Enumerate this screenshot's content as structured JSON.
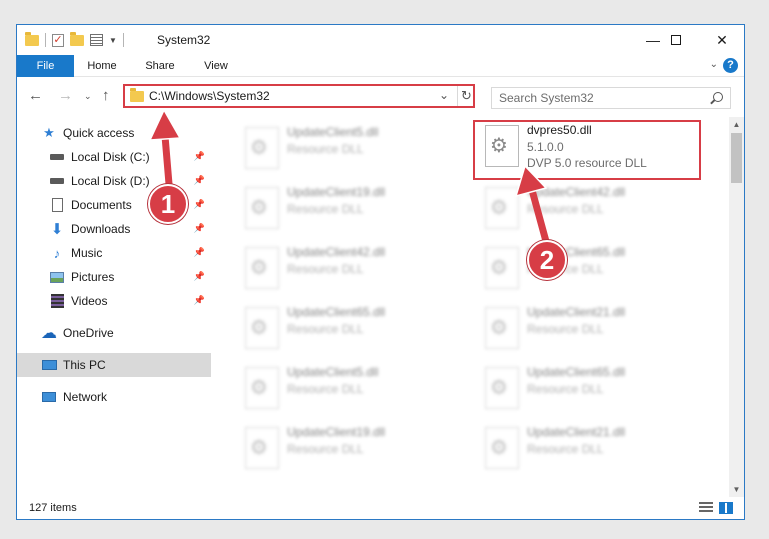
{
  "window": {
    "title": "System32"
  },
  "ribbon": {
    "tabs": [
      {
        "label": "File"
      },
      {
        "label": "Home"
      },
      {
        "label": "Share"
      },
      {
        "label": "View"
      }
    ]
  },
  "address": {
    "path": "C:\\Windows\\System32"
  },
  "search": {
    "placeholder": "Search System32"
  },
  "nav_pane": {
    "items": [
      {
        "label": "Quick access",
        "icon": "star-icon"
      },
      {
        "label": "Local Disk (C:)",
        "icon": "drive-icon",
        "pinned": true
      },
      {
        "label": "Local Disk (D:)",
        "icon": "drive-icon",
        "pinned": true
      },
      {
        "label": "Documents",
        "icon": "document-icon",
        "pinned": true
      },
      {
        "label": "Downloads",
        "icon": "download-icon",
        "pinned": true
      },
      {
        "label": "Music",
        "icon": "music-icon",
        "pinned": true
      },
      {
        "label": "Pictures",
        "icon": "pictures-icon",
        "pinned": true
      },
      {
        "label": "Videos",
        "icon": "videos-icon",
        "pinned": true
      },
      {
        "label": "OneDrive",
        "icon": "cloud-icon"
      },
      {
        "label": "This PC",
        "icon": "computer-icon",
        "selected": true
      },
      {
        "label": "Network",
        "icon": "network-icon"
      }
    ]
  },
  "files": {
    "left_column": [
      {
        "name": "UpdateClient5.dll",
        "type": "Resource DLL"
      },
      {
        "name": "UpdateClient19.dll",
        "type": "Resource DLL"
      },
      {
        "name": "UpdateClient42.dll",
        "type": "Resource DLL"
      },
      {
        "name": "UpdateClient65.dll",
        "type": "Resource DLL"
      },
      {
        "name": "UpdateClient5.dll",
        "type": "Resource DLL"
      },
      {
        "name": "UpdateClient19.dll",
        "type": "Resource DLL"
      }
    ],
    "right_column": [
      {
        "name": "UpdateClient42.dll",
        "type": "Resource DLL"
      },
      {
        "name": "UpdateClient65.dll",
        "type": "Resource DLL"
      },
      {
        "name": "UpdateClient21.dll",
        "type": "Resource DLL"
      },
      {
        "name": "UpdateClient65.dll",
        "type": "Resource DLL"
      },
      {
        "name": "UpdateClient21.dll",
        "type": "Resource DLL"
      }
    ],
    "highlighted": {
      "name": "dvpres50.dll",
      "version": "5.1.0.0",
      "description": "DVP 5.0 resource DLL"
    }
  },
  "status": {
    "item_count": "127 items"
  },
  "annotations": [
    {
      "label": "1"
    },
    {
      "label": "2"
    }
  ],
  "colors": {
    "accent": "#1979ca",
    "annotation": "#d73d46",
    "selected_bg": "#d9d9d9"
  }
}
